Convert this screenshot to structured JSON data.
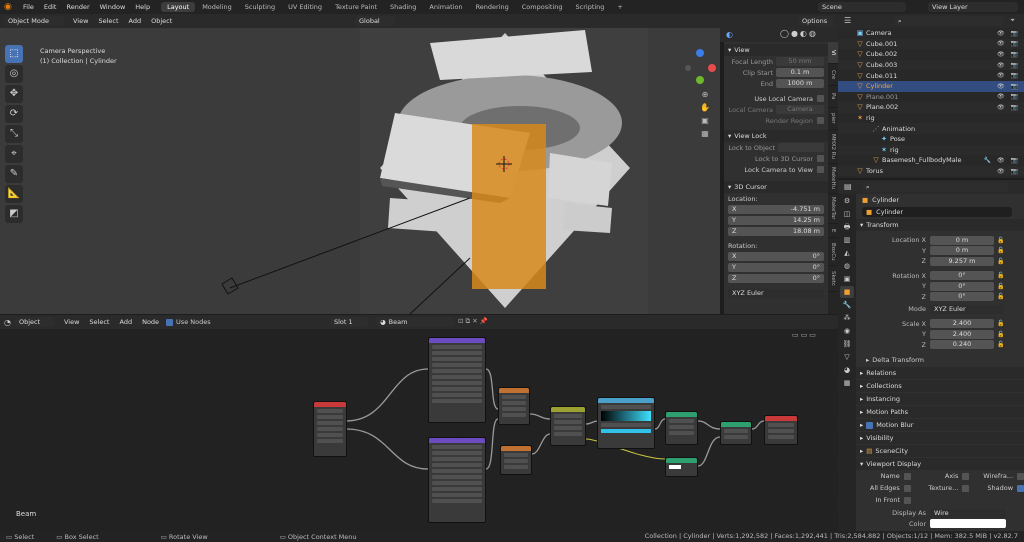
{
  "menus": [
    "File",
    "Edit",
    "Render",
    "Window",
    "Help"
  ],
  "workspaces": [
    "Layout",
    "Modeling",
    "Sculpting",
    "UV Editing",
    "Texture Paint",
    "Shading",
    "Animation",
    "Rendering",
    "Compositing",
    "Scripting"
  ],
  "scene": "Scene",
  "view_layer": "View Layer",
  "viewport": {
    "mode": "Object Mode",
    "menu": [
      "View",
      "Select",
      "Add",
      "Object"
    ],
    "orientation": "Global",
    "options": "Options",
    "info_line1": "Camera Perspective",
    "info_line2": "(1) Collection | Cylinder"
  },
  "npanel": {
    "view_title": "View",
    "focal_length_label": "Focal Length",
    "focal_length": "50 mm",
    "clip_start_label": "Clip Start",
    "clip_start": "0.1 m",
    "end_label": "End",
    "end": "1000 m",
    "use_local_camera": "Use Local Camera",
    "local_camera_label": "Local Camera",
    "local_camera": "Camera",
    "render_region": "Render Region",
    "view_lock_title": "View Lock",
    "lock_to_object": "Lock to Object",
    "lock_to_3d_cursor": "Lock to 3D Cursor",
    "lock_camera_to_view": "Lock Camera to View",
    "cursor_title": "3D Cursor",
    "location_label": "Location:",
    "loc": [
      {
        "axis": "X",
        "value": "-4.751 m"
      },
      {
        "axis": "Y",
        "value": "14.25 m"
      },
      {
        "axis": "Z",
        "value": "18.08 m"
      }
    ],
    "rotation_label": "Rotation:",
    "rot": [
      {
        "axis": "X",
        "value": "0°"
      },
      {
        "axis": "Y",
        "value": "0°"
      },
      {
        "axis": "Z",
        "value": "0°"
      }
    ],
    "rot_mode": "XYZ Euler",
    "tabs": [
      "Vi",
      "Cre",
      "Pa",
      "pier",
      "MHX2 Ru",
      "MakeHu",
      "MakeTar",
      "E",
      "BoxCu",
      "Sketc"
    ]
  },
  "node_editor": {
    "type": "Object",
    "menu": [
      "View",
      "Select",
      "Add",
      "Node"
    ],
    "use_nodes": "Use Nodes",
    "slot": "Slot 1",
    "material": "Beam",
    "frame_label": "Beam"
  },
  "outliner": {
    "items": [
      {
        "name": "Camera",
        "icon": "camera-icon",
        "indent": 1
      },
      {
        "name": "Cube.001",
        "icon": "mesh-icon",
        "indent": 1
      },
      {
        "name": "Cube.002",
        "icon": "mesh-icon",
        "indent": 1
      },
      {
        "name": "Cube.003",
        "icon": "mesh-icon",
        "indent": 1
      },
      {
        "name": "Cube.011",
        "icon": "mesh-icon",
        "indent": 1
      },
      {
        "name": "Cylinder",
        "icon": "mesh-icon",
        "indent": 1,
        "selected": true
      },
      {
        "name": "Plane.001",
        "icon": "mesh-icon",
        "indent": 1
      },
      {
        "name": "Plane.002",
        "icon": "mesh-icon",
        "indent": 1
      },
      {
        "name": "rig",
        "icon": "armature-icon",
        "indent": 1
      },
      {
        "name": "Animation",
        "icon": "action-icon",
        "indent": 2
      },
      {
        "name": "Pose",
        "icon": "pose-icon",
        "indent": 2
      },
      {
        "name": "rig",
        "icon": "armature-data-icon",
        "indent": 2
      },
      {
        "name": "Basemesh_FullbodyMale",
        "icon": "mesh-icon",
        "indent": 2
      },
      {
        "name": "Torus",
        "icon": "mesh-icon",
        "indent": 1
      }
    ]
  },
  "properties": {
    "object_name": "Cylinder",
    "object_field": "Cylinder",
    "transform_title": "Transform",
    "location": [
      {
        "label": "Location X",
        "value": "0 m"
      },
      {
        "label": "Y",
        "value": "0 m"
      },
      {
        "label": "Z",
        "value": "9.257 m"
      }
    ],
    "rotation": [
      {
        "label": "Rotation X",
        "value": "0°"
      },
      {
        "label": "Y",
        "value": "0°"
      },
      {
        "label": "Z",
        "value": "0°"
      }
    ],
    "mode_label": "Mode",
    "mode": "XYZ Euler",
    "scale": [
      {
        "label": "Scale X",
        "value": "2.400"
      },
      {
        "label": "Y",
        "value": "2.400"
      },
      {
        "label": "Z",
        "value": "0.240"
      }
    ],
    "delta_transform": "Delta Transform",
    "relations": "Relations",
    "collections": "Collections",
    "instancing": "Instancing",
    "motion_paths": "Motion Paths",
    "motion_blur": "Motion Blur",
    "visibility": "Visibility",
    "scenecity": "SceneCity",
    "viewport_display": "Viewport Display",
    "name": "Name",
    "axis": "Axis",
    "wireframe": "Wirefra...",
    "all_edges": "All Edges",
    "texture": "Texture...",
    "shadow": "Shadow",
    "in_front": "In Front",
    "display_as_label": "Display As",
    "display_as": "Wire",
    "color_label": "Color"
  },
  "status": {
    "select": "Select",
    "box_select": "Box Select",
    "rotate_view": "Rotate View",
    "context_menu": "Object Context Menu",
    "stats": "Collection | Cylinder | Verts:1,292,582 | Faces:1,292,441 | Tris:2,584,882 | Objects:1/12 | Mem: 382.5 MiB | v2.82.7"
  }
}
